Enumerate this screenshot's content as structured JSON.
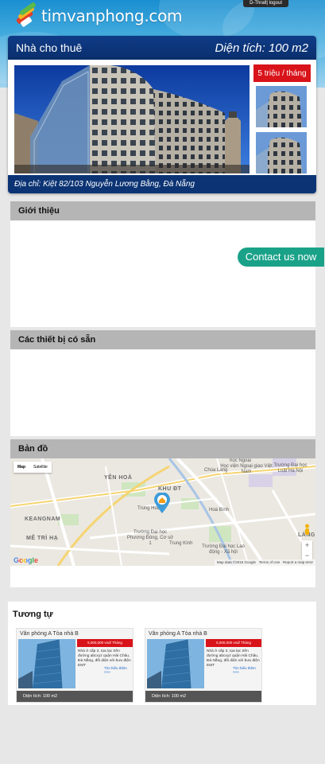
{
  "header": {
    "logo_text": "timvanphong.com",
    "user_link": "D-Thrall",
    "separator": "|",
    "logout_link": "logout"
  },
  "property": {
    "title": "Nhà cho thuê",
    "area": "Diện tích: 100 m2",
    "price": "5 triệu / tháng",
    "address": "Địa chỉ: Kiệt 82/103 Nguyễn Lương Bằng, Đà Nẵng"
  },
  "sections": {
    "intro": "Giới thiệu",
    "equipment": "Các thiết bị có sẵn",
    "map": "Bản đồ"
  },
  "contact_button": "Contact us now",
  "map": {
    "type_map": "Map",
    "type_satellite": "Satellite",
    "zoom_in": "+",
    "zoom_out": "−",
    "google": "Google",
    "footer_data": "Map data ©2016 Google",
    "footer_terms": "Terms of Use",
    "footer_report": "Report a map error",
    "labels": {
      "yen_hoa": "YÊN HOÀ",
      "keangnam": "KEANGNAM",
      "me_tri_ha": "MỄ TRÌ HẠ",
      "khu_dt": "KHU ĐT",
      "trung_hoa": "Trung Hoà",
      "hoc_vien": "Học viện Ngoại giao Việt Nam",
      "hoc_ngoai": "học Ngoại",
      "dh_luat": "Trường Đại học Luật Hà Nội",
      "phuong_dong": "Trường Đại học Phương Đông, Cơ sở 1",
      "lao_dong": "Trường Đại học Lao động - Xã hội",
      "lang": "LÁNG",
      "chua_lang": "Chùa Láng",
      "hoa_binh": "Hoà Bình",
      "trung_kinh": "Trung Kính"
    }
  },
  "similar": {
    "title": "Tương tự",
    "items": [
      {
        "name": "Văn phòng A Tòa nhà B",
        "price": "5,000,000 vnd/ Tháng",
        "desc": "Nhà ở cấp 3, tọa lạc trên đường abcxyz quận Hải Châu, Đà Nẵng, đối diện với bưu điện EMT",
        "more": "Tìm hiểu thêm >>>",
        "area": "Diện tích: 100 m2"
      },
      {
        "name": "Văn phòng A Tòa nhà B",
        "price": "5,000,000 vnd/ Tháng",
        "desc": "Nhà ở cấp 3, tọa lạc trên đường abcxyz quận Hải Châu, Đà Nẵng, đối diện với bưu điện EMT",
        "more": "Tìm hiểu thêm >>>",
        "area": "Diện tích: 100 m2"
      }
    ]
  }
}
